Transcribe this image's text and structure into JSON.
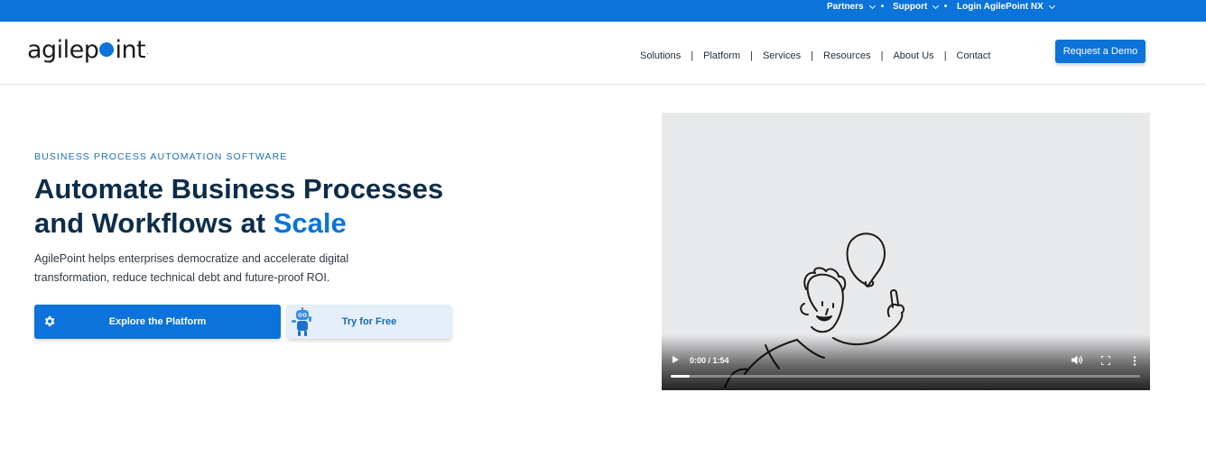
{
  "topbar": {
    "items": [
      {
        "label": "Partners"
      },
      {
        "label": "Support"
      },
      {
        "label": "Login AgilePoint NX"
      }
    ],
    "bg_color": "#0b73d9"
  },
  "header": {
    "logo": {
      "text_before": "agilep",
      "text_after": "int",
      "reg": "."
    },
    "nav": [
      {
        "label": "Solutions"
      },
      {
        "label": "Platform"
      },
      {
        "label": "Services"
      },
      {
        "label": "Resources"
      },
      {
        "label": "About Us"
      },
      {
        "label": "Contact"
      }
    ],
    "nav_separator": "|",
    "cta_label": "Request a Demo"
  },
  "hero": {
    "eyebrow": "BUSINESS PROCESS AUTOMATION SOFTWARE",
    "headline_line1": "Automate Business Processes",
    "headline_line2": "and Workflows at ",
    "headline_accent": "Scale",
    "lead": "AgilePoint helps enterprises democratize and accelerate digital transformation, reduce technical debt and future-proof ROI.",
    "primary_button": {
      "label": "Explore the Platform",
      "icon": "gear-icon"
    },
    "secondary_button": {
      "label": "Try for Free",
      "icon": "robot-mascot-icon"
    }
  },
  "video": {
    "current_time": "0:00",
    "time_separator": " / ",
    "duration": "1:54",
    "progress": 0.04,
    "icons": [
      "play-icon",
      "volume-icon",
      "fullscreen-icon",
      "more-options-icon"
    ]
  },
  "colors": {
    "brand_blue": "#0b73d9",
    "heading_navy": "#0c2d4a",
    "secondary_button_bg": "#e5eff9"
  }
}
